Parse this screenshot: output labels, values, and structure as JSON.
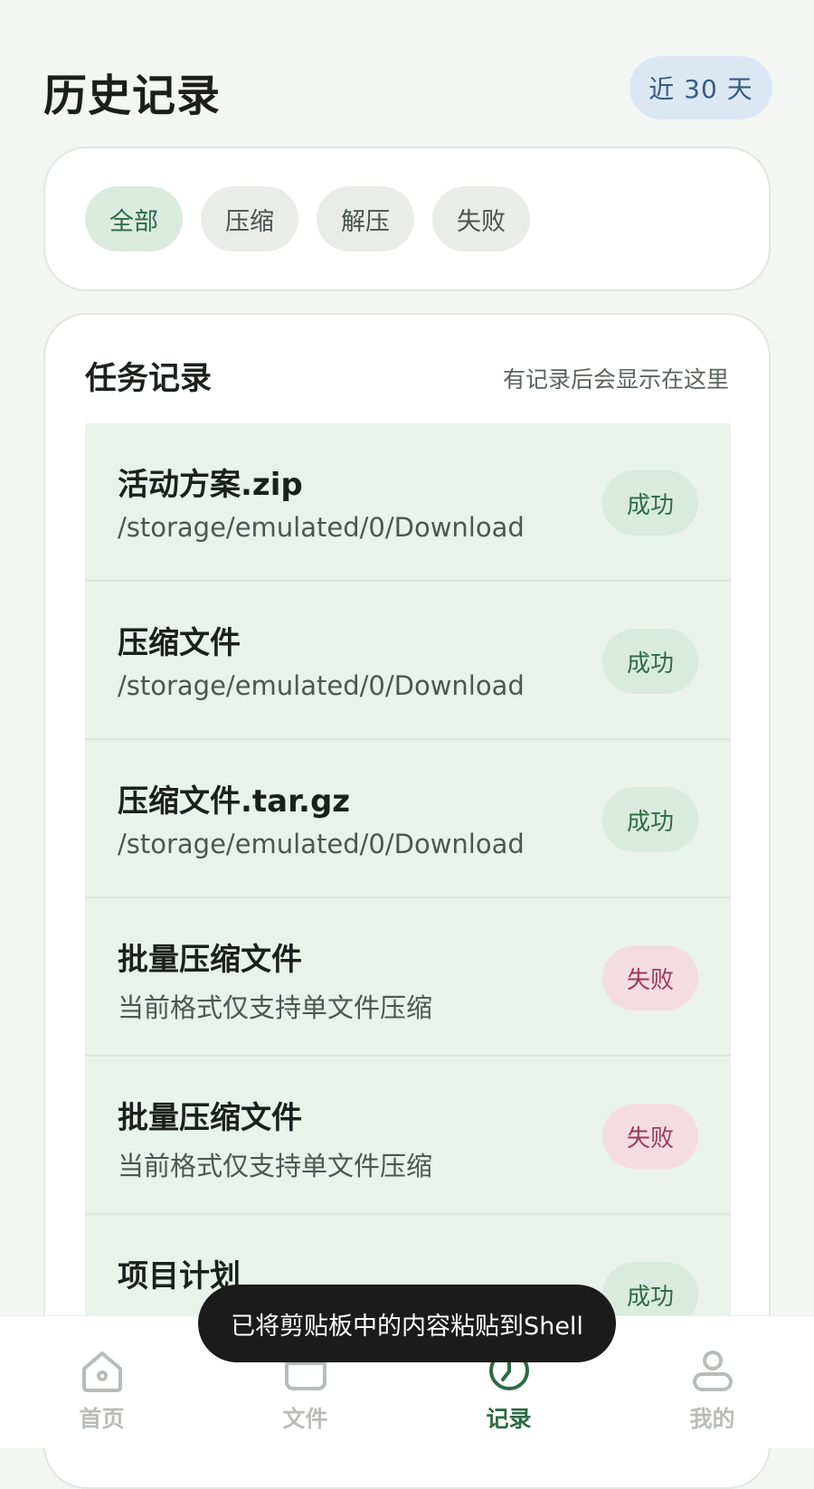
{
  "header": {
    "title": "历史记录",
    "range_label": "近 30 天"
  },
  "filters": [
    {
      "label": "全部",
      "active": true
    },
    {
      "label": "压缩",
      "active": false
    },
    {
      "label": "解压",
      "active": false
    },
    {
      "label": "失败",
      "active": false
    }
  ],
  "task_list": {
    "title": "任务记录",
    "hint": "有记录后会显示在这里",
    "rows": [
      {
        "name": "活动方案.zip",
        "detail": "/storage/emulated/0/Download",
        "status": "成功",
        "status_type": "success"
      },
      {
        "name": "压缩文件",
        "detail": "/storage/emulated/0/Download",
        "status": "成功",
        "status_type": "success"
      },
      {
        "name": "压缩文件.tar.gz",
        "detail": "/storage/emulated/0/Download",
        "status": "成功",
        "status_type": "success"
      },
      {
        "name": "批量压缩文件",
        "detail": "当前格式仅支持单文件压缩",
        "status": "失败",
        "status_type": "failed"
      },
      {
        "name": "批量压缩文件",
        "detail": "当前格式仅支持单文件压缩",
        "status": "失败",
        "status_type": "failed"
      },
      {
        "name": "项目计划",
        "detail": "",
        "status": "成功",
        "status_type": "success"
      }
    ]
  },
  "toast": {
    "message": "已将剪贴板中的内容粘贴到Shell"
  },
  "bottom_nav": [
    {
      "label": "首页",
      "icon": "home-icon",
      "active": false
    },
    {
      "label": "文件",
      "icon": "folder-icon",
      "active": false
    },
    {
      "label": "记录",
      "icon": "clock-icon",
      "active": true
    },
    {
      "label": "我的",
      "icon": "user-icon",
      "active": false
    }
  ],
  "colors": {
    "accent": "#2d6a43",
    "success_bg": "#d9eadf",
    "failed_bg": "#f4dce3",
    "failed_text": "#9a3c55",
    "range_chip_bg": "#dbe8f4"
  }
}
